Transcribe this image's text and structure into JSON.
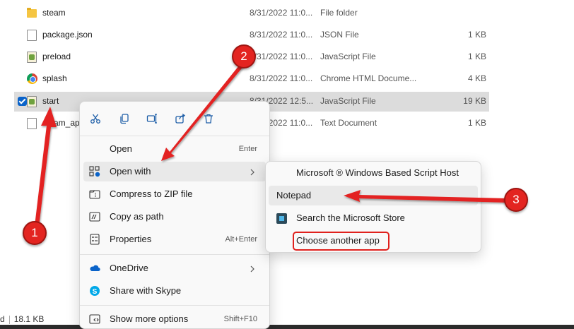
{
  "files": [
    {
      "name": "steam",
      "date": "8/31/2022 11:0...",
      "type": "File folder",
      "size": "",
      "icon": "folder-icon"
    },
    {
      "name": "package.json",
      "date": "8/31/2022 11:0...",
      "type": "JSON File",
      "size": "1 KB",
      "icon": "document-icon"
    },
    {
      "name": "preload",
      "date": "8/31/2022 11:0...",
      "type": "JavaScript File",
      "size": "1 KB",
      "icon": "javascript-file-icon"
    },
    {
      "name": "splash",
      "date": "8/31/2022 11:0...",
      "type": "Chrome HTML Docume...",
      "size": "4 KB",
      "icon": "chrome-icon"
    },
    {
      "name": "start",
      "date": "8/31/2022 12:5...",
      "type": "JavaScript File",
      "size": "19 KB",
      "icon": "javascript-file-icon",
      "selected": true
    },
    {
      "name": "steam_ap",
      "date": "8/31/2022 11:0...",
      "type": "Text Document",
      "size": "1 KB",
      "icon": "text-document-icon"
    }
  ],
  "status_bar": {
    "left_char": "d",
    "selection_size": "18.1 KB"
  },
  "context_menu": {
    "quick_actions": [
      "cut-icon",
      "copy-icon",
      "rename-icon",
      "share-icon",
      "delete-icon"
    ],
    "items": {
      "open": {
        "label": "Open",
        "shortcut": "Enter"
      },
      "open_with": {
        "label": "Open with"
      },
      "compress": {
        "label": "Compress to ZIP file"
      },
      "copy_path": {
        "label": "Copy as path"
      },
      "properties": {
        "label": "Properties",
        "shortcut": "Alt+Enter"
      },
      "onedrive": {
        "label": "OneDrive"
      },
      "share_skype": {
        "label": "Share with Skype"
      },
      "show_more": {
        "label": "Show more options",
        "shortcut": "Shift+F10"
      }
    }
  },
  "submenu": {
    "items": {
      "wsh": {
        "label": "Microsoft ® Windows Based Script Host"
      },
      "notepad": {
        "label": "Notepad"
      },
      "store": {
        "label": "Search the Microsoft Store"
      },
      "choose": {
        "label": "Choose another app"
      }
    }
  },
  "annotations": [
    {
      "number": "1"
    },
    {
      "number": "2"
    },
    {
      "number": "3"
    }
  ],
  "colors": {
    "accent": "#0a63c9",
    "annotation": "#e32420",
    "selection": "#dcdcdc"
  }
}
